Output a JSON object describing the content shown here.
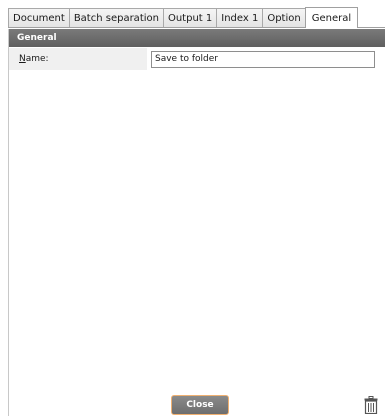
{
  "tabs": [
    {
      "label": "Document",
      "active": false
    },
    {
      "label": "Batch separation",
      "active": false
    },
    {
      "label": "Output 1",
      "active": false
    },
    {
      "label": "Index 1",
      "active": false
    },
    {
      "label": "Option",
      "active": false
    },
    {
      "label": "General",
      "active": true
    }
  ],
  "section": {
    "title": "General"
  },
  "name_field": {
    "label_accel": "N",
    "label_rest": "ame:",
    "value": "Save to folder"
  },
  "footer": {
    "close_label": "Close",
    "delete_icon": "trash-icon"
  },
  "colors": {
    "header_bg": "#666666",
    "button_border": "#f0b070"
  }
}
